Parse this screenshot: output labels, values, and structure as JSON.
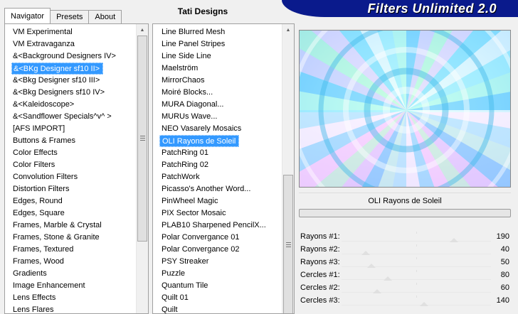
{
  "tabs": [
    {
      "label": "Navigator",
      "active": true
    },
    {
      "label": "Presets",
      "active": false
    },
    {
      "label": "About",
      "active": false
    }
  ],
  "subtitle": "Tati Designs",
  "banner": {
    "title": "Filters Unlimited 2.0"
  },
  "left_list": {
    "items": [
      "VM Experimental",
      "VM Extravaganza",
      "&<Background Designers IV>",
      "&<BKg Designer sf10 II>",
      "&<Bkg Designer sf10 III>",
      "&<Bkg Designers sf10 IV>",
      "&<Kaleidoscope>",
      "&<Sandflower Specials^v^ >",
      "[AFS IMPORT]",
      "Buttons & Frames",
      "Color Effects",
      "Color Filters",
      "Convolution Filters",
      "Distortion Filters",
      "Edges, Round",
      "Edges, Square",
      "Frames, Marble & Crystal",
      "Frames, Stone & Granite",
      "Frames, Textured",
      "Frames, Wood",
      "Gradients",
      "Image Enhancement",
      "Lens Effects",
      "Lens Flares"
    ],
    "selected_index": 3
  },
  "mid_list": {
    "items": [
      "Line Blurred Mesh",
      "Line Panel Stripes",
      "Line Side Line",
      "Maelström",
      "MirrorChaos",
      "Moiré Blocks...",
      "MURA Diagonal...",
      "MURUs Wave...",
      "NEO Vasarely Mosaics",
      "OLI Rayons de Soleil",
      "PatchRing 01",
      "PatchRing 02",
      "PatchWork",
      "Picasso's Another Word...",
      "PinWheel Magic",
      "PIX Sector Mosaic",
      "PLAB10 Sharpened PencilX...",
      "Polar Convergance 01",
      "Polar Convergance 02",
      "PSY Streaker",
      "Puzzle",
      "Quantum Tile",
      "Quilt 01",
      "Quilt"
    ],
    "selected_index": 9
  },
  "preview": {
    "filter_name": "OLI Rayons de Soleil"
  },
  "params": [
    {
      "label": "Rayons #1:",
      "value": "190",
      "fraction": 0.75
    },
    {
      "label": "Rayons #2:",
      "value": "40",
      "fraction": 0.16
    },
    {
      "label": "Rayons #3:",
      "value": "50",
      "fraction": 0.2
    },
    {
      "label": "Cercles #1:",
      "value": "80",
      "fraction": 0.31
    },
    {
      "label": "Cercles #2:",
      "value": "60",
      "fraction": 0.24
    },
    {
      "label": "Cercles #3:",
      "value": "140",
      "fraction": 0.55
    }
  ],
  "colors": {
    "banner": "#0a1a8c",
    "selection": "#3399ff"
  }
}
